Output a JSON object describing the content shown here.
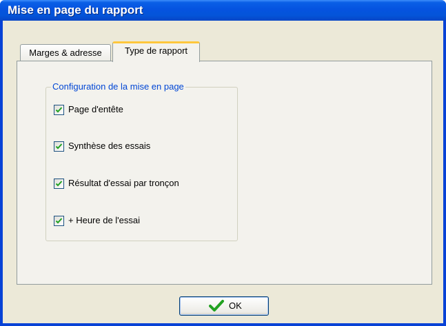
{
  "window": {
    "title": "Mise en page du rapport"
  },
  "tabs": [
    {
      "label": "Marges & adresse",
      "active": false
    },
    {
      "label": "Type de rapport",
      "active": true
    }
  ],
  "group": {
    "label": "Configuration de la mise en page",
    "options": [
      {
        "label": "Page d'entête",
        "checked": true
      },
      {
        "label": "Synthèse des essais",
        "checked": true
      },
      {
        "label": "Résultat d'essai par tronçon",
        "checked": true
      },
      {
        "label": "+ Heure de l'essai",
        "checked": true
      }
    ]
  },
  "buttons": {
    "ok_label": "OK",
    "ok_icon": "green-checkmark-icon"
  },
  "colors": {
    "titlebar": "#0553e0",
    "accent_tab": "#ffc73c",
    "checkmark": "#21a121",
    "group_label": "#0046d5"
  }
}
